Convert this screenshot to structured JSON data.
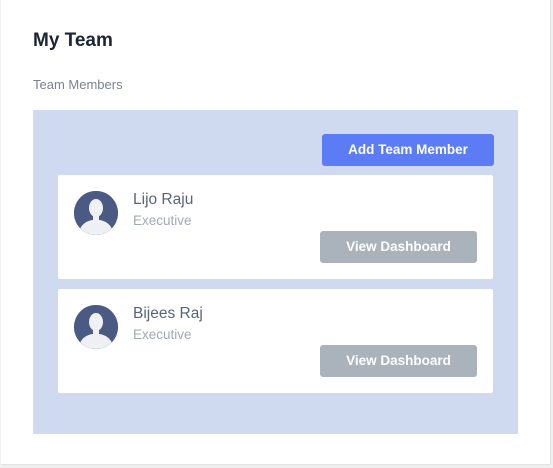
{
  "page": {
    "title": "My Team",
    "section_label": "Team Members"
  },
  "actions": {
    "add_member_label": "Add Team Member"
  },
  "colors": {
    "accent": "#5b7cf4",
    "team_area_background": "#cfdaf0",
    "secondary_button": "#aab2bc",
    "avatar_background": "#4a5a82"
  },
  "members": [
    {
      "name": "Lijo Raju",
      "role": "Executive",
      "avatar_icon": "user-silhouette-icon",
      "button_label": "View Dashboard"
    },
    {
      "name": "Bijees Raj",
      "role": "Executive",
      "avatar_icon": "user-silhouette-icon",
      "button_label": "View Dashboard"
    }
  ]
}
